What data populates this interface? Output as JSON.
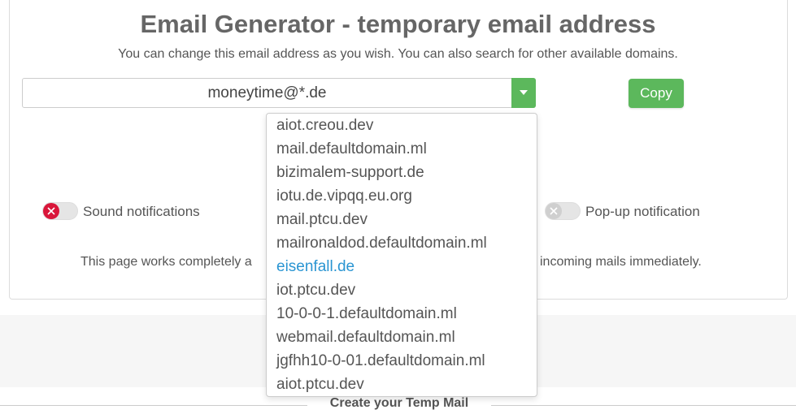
{
  "header": {
    "title": "Email Generator - temporary email address",
    "subtitle": "You can change this email address as you wish. You can also search for other available domains."
  },
  "email": {
    "value": "moneytime@*.de",
    "dropdown_toggle_icon": "caret-down-icon"
  },
  "copy_button": {
    "label": "Copy",
    "color": "#5cb85c"
  },
  "toggles": {
    "sound": {
      "label": "Sound notifications",
      "state": "off",
      "icon": "close-icon",
      "color": "#d9163a"
    },
    "popup": {
      "label": "Pop-up notification",
      "state": "off",
      "icon": "close-icon",
      "color": "#cfcfcf"
    }
  },
  "info": {
    "left": "This page works completely a",
    "right": "incoming mails immediately."
  },
  "domains": {
    "selected": "eisenfall.de",
    "options": [
      "aiot.creou.dev",
      "mail.defaultdomain.ml",
      "bizimalem-support.de",
      "iotu.de.vipqq.eu.org",
      "mail.ptcu.dev",
      "mailronaldod.defaultdomain.ml",
      "eisenfall.de",
      "iot.ptcu.dev",
      "10-0-0-1.defaultdomain.ml",
      "webmail.defaultdomain.ml",
      "jgfhh10-0-01.defaultdomain.ml",
      "aiot.ptcu.dev"
    ]
  },
  "section": {
    "title": "Create your Temp Mail"
  },
  "colors": {
    "accent": "#5cb85c",
    "link": "#2a95d2"
  }
}
